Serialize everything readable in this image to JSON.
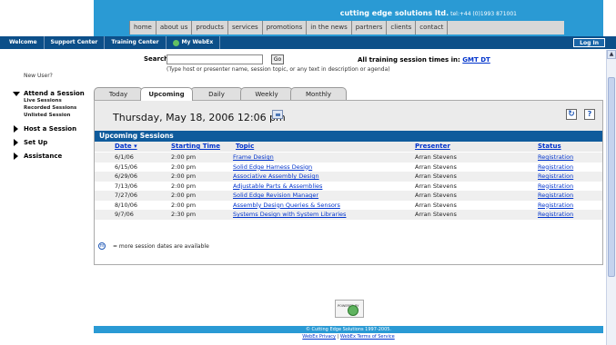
{
  "banner": {
    "title": "cutting edge solutions ltd.",
    "tel": " tel:+44 (0)1993 871001"
  },
  "nav": [
    "home",
    "about us",
    "products",
    "services",
    "promotions",
    "in the news",
    "partners",
    "clients",
    "contact"
  ],
  "strip": {
    "items": [
      "Welcome",
      "Support Center",
      "Training Center"
    ],
    "webex": "My WebEx",
    "login": "Log In"
  },
  "sidebar": {
    "new_user": "New User?",
    "attend": "Attend a Session",
    "attend_sub": [
      "Live Sessions",
      "Recorded Sessions",
      "Unlisted Session"
    ],
    "host": "Host a Session",
    "setup": "Set Up",
    "assistance": "Assistance"
  },
  "search": {
    "label": "Search for:",
    "value": "",
    "go": "Go",
    "hint": "(Type host or presenter name, session topic, or any text in description or agenda)",
    "tz_prefix": "All training session times in: ",
    "tz_link": "GMT DT"
  },
  "tabs": [
    "Today",
    "Upcoming",
    "Daily",
    "Weekly",
    "Monthly"
  ],
  "active_tab": "Upcoming",
  "date_display": "Thursday, May 18, 2006 12:06 pm",
  "icons": {
    "refresh": "↻",
    "help": "?",
    "more": "m"
  },
  "sessions": {
    "heading": "Upcoming Sessions",
    "columns": {
      "date": "Date ▾",
      "time": "Starting Time",
      "topic": "Topic",
      "presenter": "Presenter",
      "status": "Status"
    },
    "rows": [
      {
        "date": "6/1/06",
        "time": "2:00 pm",
        "topic": "Frame Design",
        "presenter": "Arran Stevens",
        "status": "Registration"
      },
      {
        "date": "6/15/06",
        "time": "2:00 pm",
        "topic": "Solid Edge Harness Design",
        "presenter": "Arran Stevens",
        "status": "Registration"
      },
      {
        "date": "6/29/06",
        "time": "2:00 pm",
        "topic": "Associative Assembly Design",
        "presenter": "Arran Stevens",
        "status": "Registration"
      },
      {
        "date": "7/13/06",
        "time": "2:00 pm",
        "topic": "Adjustable Parts & Assemblies",
        "presenter": "Arran Stevens",
        "status": "Registration"
      },
      {
        "date": "7/27/06",
        "time": "2:00 pm",
        "topic": "Solid Edge Revision Manager",
        "presenter": "Arran Stevens",
        "status": "Registration"
      },
      {
        "date": "8/10/06",
        "time": "2:00 pm",
        "topic": "Assembly Design Queries & Sensors",
        "presenter": "Arran Stevens",
        "status": "Registration"
      },
      {
        "date": "9/7/06",
        "time": "2:30 pm",
        "topic": "Systems Design with System Libraries",
        "presenter": "Arran Stevens",
        "status": "Registration"
      }
    ],
    "legend": "= more session dates are available"
  },
  "powered": {
    "text": "POWERED BY",
    "brand": "WebEx"
  },
  "footer": {
    "copyright": "© Cutting Edge Solutions 1997-2005.",
    "privacy": "WebEx Privacy",
    "sep": " | ",
    "terms": "WebEx Terms of Service"
  },
  "colors": {
    "banner": "#2a9ad4",
    "strip": "#0c4f89",
    "header": "#0f5b9c",
    "link": "#0033cc"
  }
}
